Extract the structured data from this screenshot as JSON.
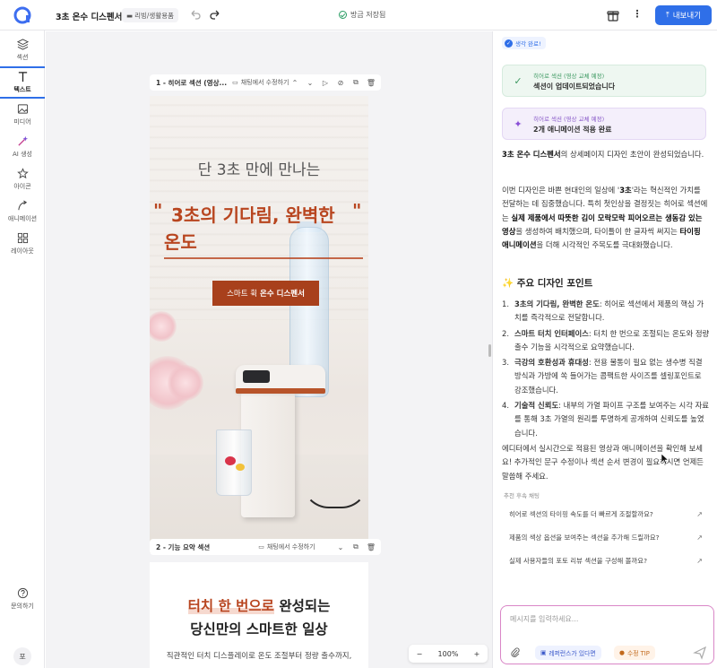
{
  "header": {
    "title": "3초 온수 디스펜서",
    "category": "리빙/생활용품",
    "save_status": "방금 저장됨",
    "export_label": "내보내기"
  },
  "sidebar": {
    "items": [
      {
        "label": "섹션"
      },
      {
        "label": "텍스트"
      },
      {
        "label": "미디어"
      },
      {
        "label": "AI 생성"
      },
      {
        "label": "아이콘"
      },
      {
        "label": "애니메이션"
      },
      {
        "label": "레이아웃"
      }
    ],
    "help_label": "문의하기",
    "avatar_text": "포"
  },
  "canvas": {
    "section1": {
      "title": "1 - 히어로 섹션 (영상...",
      "chat_edit": "채팅에서 수정하기",
      "subtitle": "단 3초 만에 만나는",
      "headline_line1": "3초의 기다림, 완벽한",
      "headline_line2": "온도",
      "quote_open": "\"",
      "quote_close": "\"",
      "cta_prefix": "스마트 휙",
      "cta_bold": "온수 디스펜서"
    },
    "section2": {
      "title": "2 - 기능 요약 섹션",
      "chat_edit": "채팅에서 수정하기",
      "headline_hl": "터치 한 번으로",
      "headline_rest": "완성되는",
      "headline_line2": "당신만의 스마트한 일상",
      "desc": "직관적인 터치 디스플레이로 온도 조절부터 정량 출수까지,"
    },
    "zoom": {
      "minus": "−",
      "value": "100%",
      "plus": "+"
    }
  },
  "chat": {
    "gen_status": "생각 완료!",
    "card1_small": "히어로 섹션 (영상 교체 예정)",
    "card1_main": "섹션이 업데이트되었습니다",
    "card2_small": "히어로 섹션 (영상 교체 예정)",
    "card2_main": "2개 애니메이션 적용 완료",
    "p1_bold": "3초 온수 디스펜서",
    "p1_rest": "의 상세페이지 디자인 초안이 완성되었습니다.",
    "p2_a": "이번 디자인은 바쁜 현대인의 일상에 '",
    "p2_b": "3초",
    "p2_c": "'라는 혁신적인 가치를 전달하는 데 집중했습니다. 특히 첫인상을 결정짓는 히어로 섹션에는 ",
    "p2_d": "실제 제품에서 따뜻한 김이 모락모락 피어오르는 생동감 있는 영상",
    "p2_e": "을 생성하여 배치했으며, 타이틀이 한 글자씩 써지는 ",
    "p2_f": "타이핑 애니메이션",
    "p2_g": "을 더해 시각적인 주목도를 극대화했습니다.",
    "points_title": "✨ 주요 디자인 포인트",
    "points": [
      {
        "num": "1.",
        "bold": "3초의 기다림, 완벽한 온도",
        "text": ": 히어로 섹션에서 제품의 핵심 가치를 즉각적으로 전달합니다."
      },
      {
        "num": "2.",
        "bold": "스마트 터치 인터페이스",
        "text": ": 터치 한 번으로 조절되는 온도와 정량 출수 기능을 시각적으로 요약했습니다."
      },
      {
        "num": "3.",
        "bold": "극강의 호환성과 휴대성",
        "text": ": 전용 물통이 필요 없는 생수병 직결 방식과 가방에 쏙 들어가는 콤팩트한 사이즈를 셀링포인트로 강조했습니다."
      },
      {
        "num": "4.",
        "bold": "기술적 신뢰도",
        "text": ": 내부의 가열 파이프 구조를 보여주는 시각 자료를 통해 3초 가열의 원리를 투명하게 공개하여 신뢰도를 높였습니다."
      }
    ],
    "p3": "에디터에서 실시간으로 적용된 영상과 애니메이션을 확인해 보세요! 추가적인 문구 수정이나 섹션 순서 변경이 필요하시면 언제든 말씀해 주세요.",
    "sugg_head": "추천 후속 채팅",
    "suggestions": [
      "히어로 섹션의 타이핑 속도를 더 빠르게 조절할까요?",
      "제품의 색상 옵션을 보여주는 섹션을 추가해 드릴까요?",
      "실제 사용자들의 포토 리뷰 섹션을 구성해 볼까요?"
    ],
    "input_placeholder": "메시지를 입력하세요...",
    "chip_ref": "레퍼런스가 있다면",
    "chip_tip": "수정 TIP"
  }
}
